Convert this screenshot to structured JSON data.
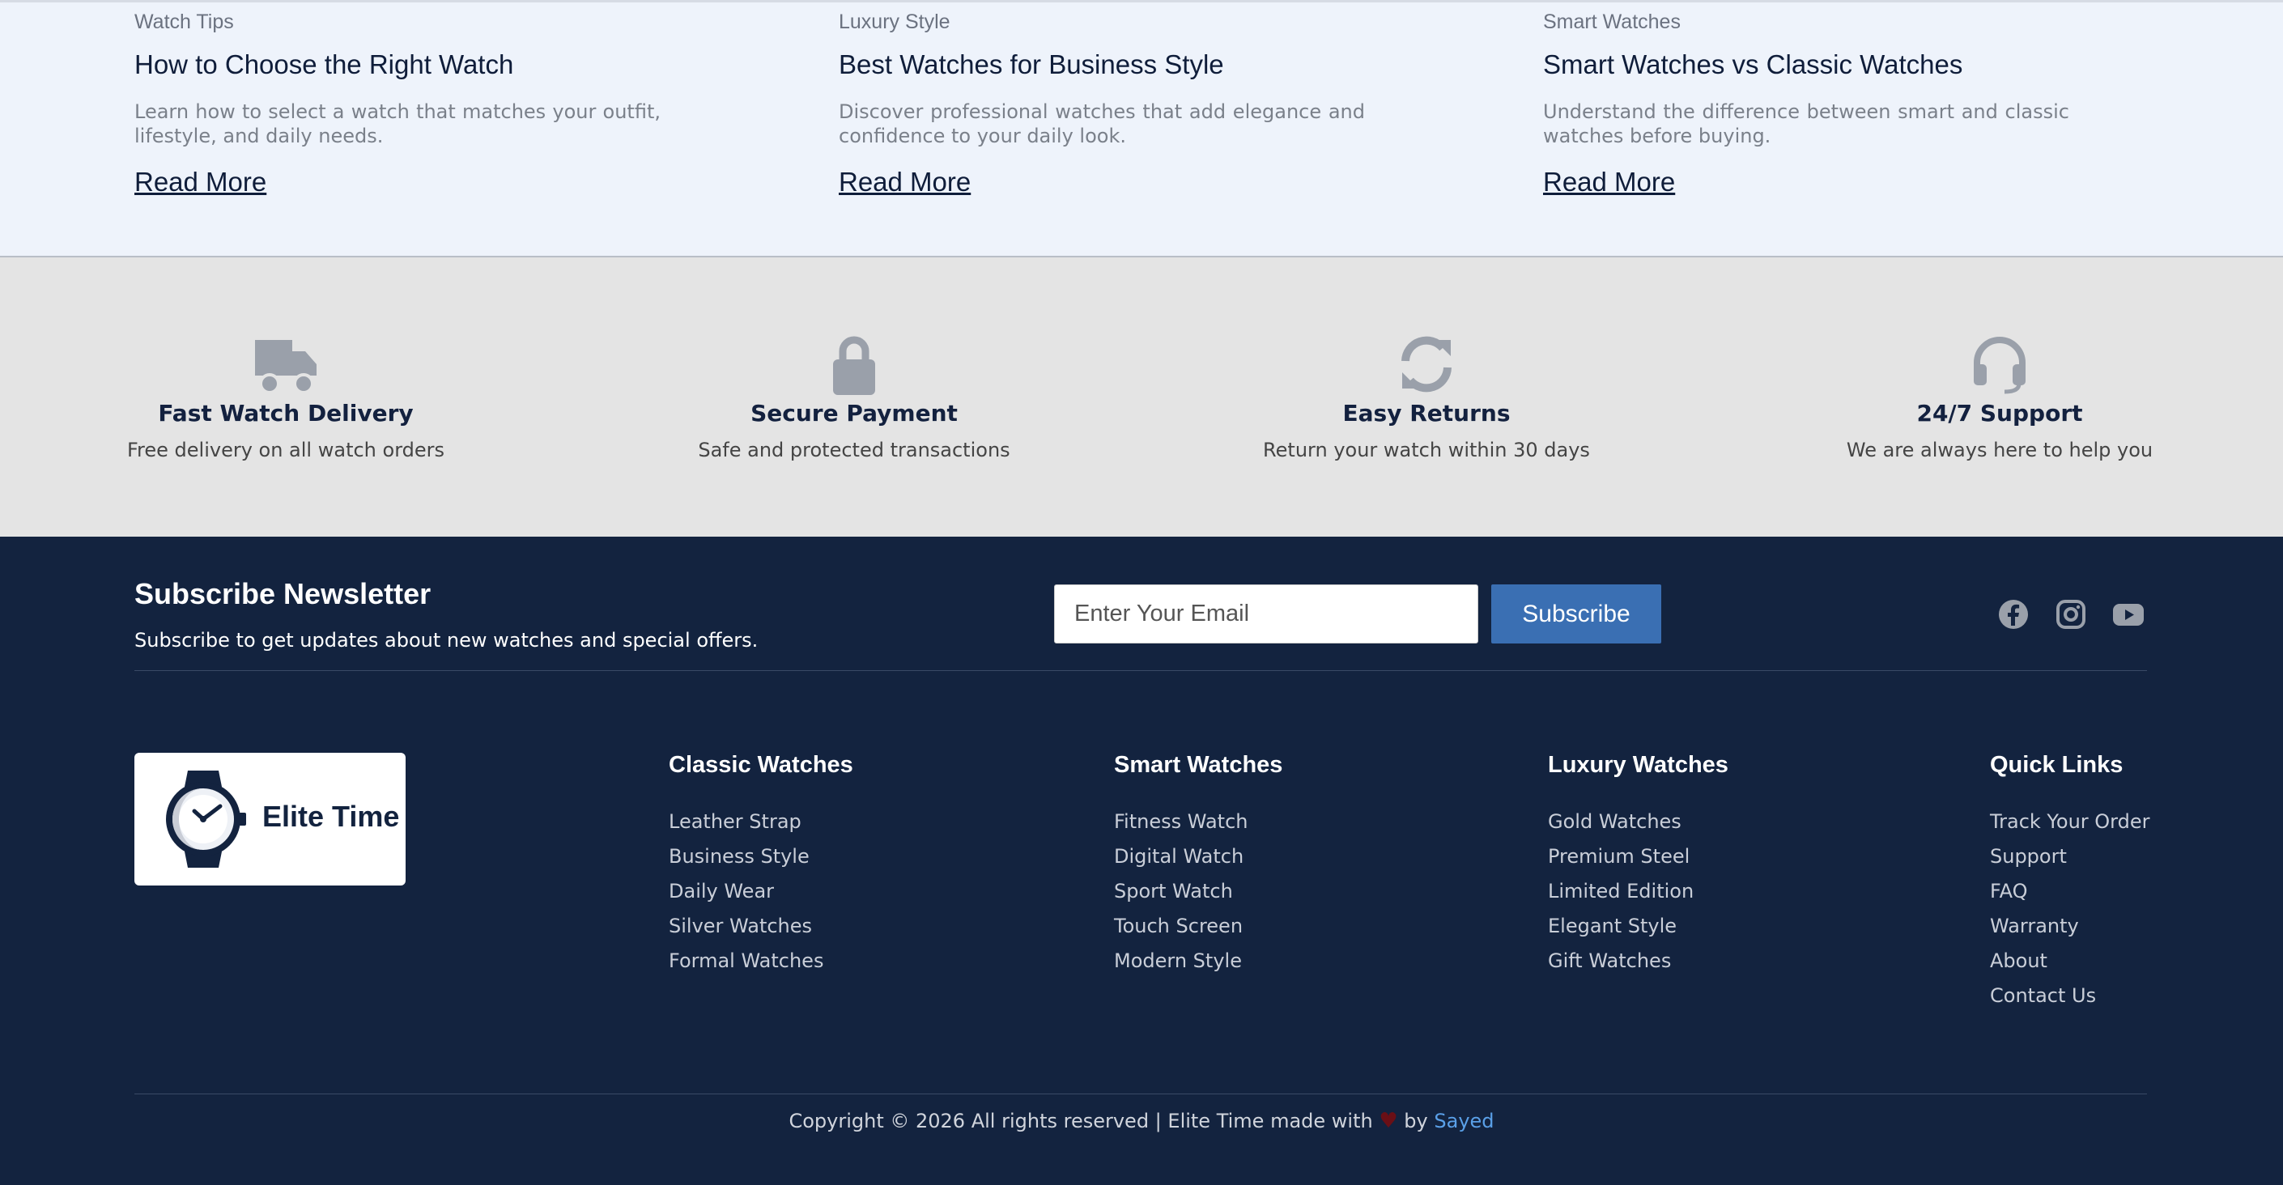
{
  "blog": {
    "cards": [
      {
        "category": "Watch Tips",
        "title": "How to Choose the Right Watch",
        "description": "Learn how to select a watch that matches your outfit, lifestyle, and daily needs.",
        "link": "Read More"
      },
      {
        "category": "Luxury Style",
        "title": "Best Watches for Business Style",
        "description": "Discover professional watches that add elegance and confidence to your daily look.",
        "link": "Read More"
      },
      {
        "category": "Smart Watches",
        "title": "Smart Watches vs Classic Watches",
        "description": "Understand the difference between smart and classic watches before buying.",
        "link": "Read More"
      }
    ]
  },
  "features": [
    {
      "icon": "truck-icon",
      "title": "Fast Watch Delivery",
      "description": "Free delivery on all watch orders"
    },
    {
      "icon": "lock-icon",
      "title": "Secure Payment",
      "description": "Safe and protected transactions"
    },
    {
      "icon": "refresh-icon",
      "title": "Easy Returns",
      "description": "Return your watch within 30 days"
    },
    {
      "icon": "headset-icon",
      "title": "24/7 Support",
      "description": "We are always here to help you"
    }
  ],
  "newsletter": {
    "title": "Subscribe Newsletter",
    "subtitle": "Subscribe to get updates about new watches and special offers.",
    "email_placeholder": "Enter Your Email",
    "button": "Subscribe"
  },
  "social": [
    "facebook-icon",
    "instagram-icon",
    "youtube-icon"
  ],
  "brand": {
    "name": "Elite Time"
  },
  "columns": [
    {
      "heading": "Classic Watches",
      "links": [
        "Leather Strap",
        "Business Style",
        "Daily Wear",
        "Silver Watches",
        "Formal Watches"
      ]
    },
    {
      "heading": "Smart Watches",
      "links": [
        "Fitness Watch",
        "Digital Watch",
        "Sport Watch",
        "Touch Screen",
        "Modern Style"
      ]
    },
    {
      "heading": "Luxury Watches",
      "links": [
        "Gold Watches",
        "Premium Steel",
        "Limited Edition",
        "Elegant Style",
        "Gift Watches"
      ]
    },
    {
      "heading": "Quick Links",
      "links": [
        "Track Your Order",
        "Support",
        "FAQ",
        "Warranty",
        "About",
        "Contact Us"
      ]
    }
  ],
  "copyright": {
    "text": "Copyright © 2026 All rights reserved | Elite Time made with",
    "heart": "♥",
    "by": "by",
    "author": "Sayed"
  },
  "colors": {
    "footer_bg": "#13233f",
    "accent": "#3a6fb3",
    "icon_gray": "#9aa0aa",
    "author_link": "#5aa0e8"
  }
}
